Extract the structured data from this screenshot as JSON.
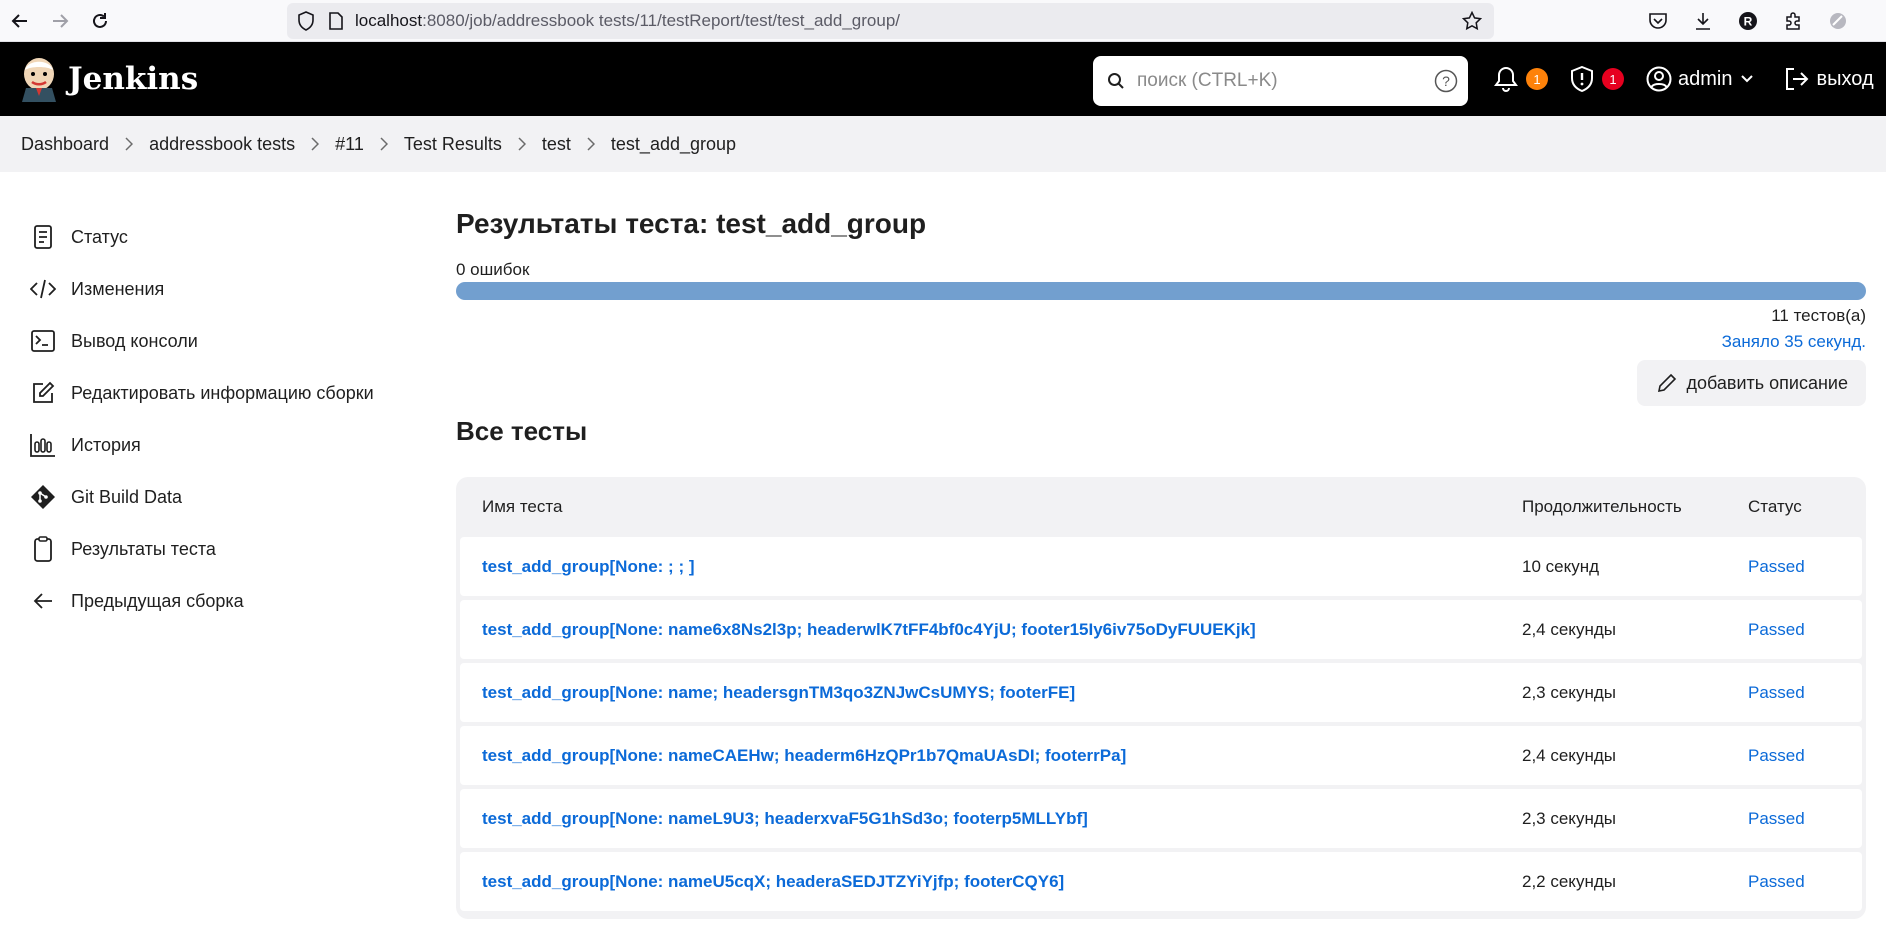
{
  "browser": {
    "url_host": "localhost",
    "url_rest": ":8080/job/addressbook tests/11/testReport/test/test_add_group/"
  },
  "header": {
    "app_name": "Jenkins",
    "search_placeholder": "поиск (CTRL+K)",
    "notifications_count": "1",
    "security_count": "1",
    "user": "admin",
    "logout": "выход"
  },
  "breadcrumb": [
    "Dashboard",
    "addressbook tests",
    "#11",
    "Test Results",
    "test",
    "test_add_group"
  ],
  "sidebar": {
    "items": [
      {
        "label": "Статус",
        "icon": "document-icon"
      },
      {
        "label": "Изменения",
        "icon": "code-icon"
      },
      {
        "label": "Вывод консоли",
        "icon": "terminal-icon"
      },
      {
        "label": "Редактировать информацию сборки",
        "icon": "edit-icon"
      },
      {
        "label": "История",
        "icon": "chart-icon"
      },
      {
        "label": "Git Build Data",
        "icon": "git-icon"
      },
      {
        "label": "Результаты теста",
        "icon": "clipboard-icon"
      },
      {
        "label": "Предыдущая сборка",
        "icon": "arrow-left-icon"
      }
    ]
  },
  "main": {
    "title": "Результаты теста: test_add_group",
    "failures": "0 ошибок",
    "pass_fraction": 1.0,
    "tests_count": "11 тестов(а)",
    "took": "Заняло 35 секунд.",
    "add_description": "добавить описание",
    "all_tests_title": "Все тесты",
    "columns": [
      "Имя теста",
      "Продолжительность",
      "Статус"
    ],
    "rows": [
      {
        "name": "test_add_group[None: ; ; ]",
        "duration": "10 секунд",
        "status": "Passed"
      },
      {
        "name": "test_add_group[None: name6x8Ns2l3p; headerwlK7tFF4bf0c4YjU; footer15Iy6iv75oDyFUUEKjk]",
        "duration": "2,4 секунды",
        "status": "Passed"
      },
      {
        "name": "test_add_group[None: name; headersgnTM3qo3ZNJwCsUMYS; footerFE]",
        "duration": "2,3 секунды",
        "status": "Passed"
      },
      {
        "name": "test_add_group[None: nameCAEHw; headerm6HzQPr1b7QmaUAsDI; footerrPa]",
        "duration": "2,4 секунды",
        "status": "Passed"
      },
      {
        "name": "test_add_group[None: nameL9U3; headerxvaF5G1hSd3o; footerp5MLLYbf]",
        "duration": "2,3 секунды",
        "status": "Passed"
      },
      {
        "name": "test_add_group[None: nameU5cqX; headeraSEDJTZYiYjfp; footerCQY6]",
        "duration": "2,2 секунды",
        "status": "Passed"
      }
    ]
  },
  "colors": {
    "accent": "#0b6ad8",
    "progress": "#729fcf",
    "badge_orange": "#fe820a",
    "badge_red": "#e6001f"
  }
}
